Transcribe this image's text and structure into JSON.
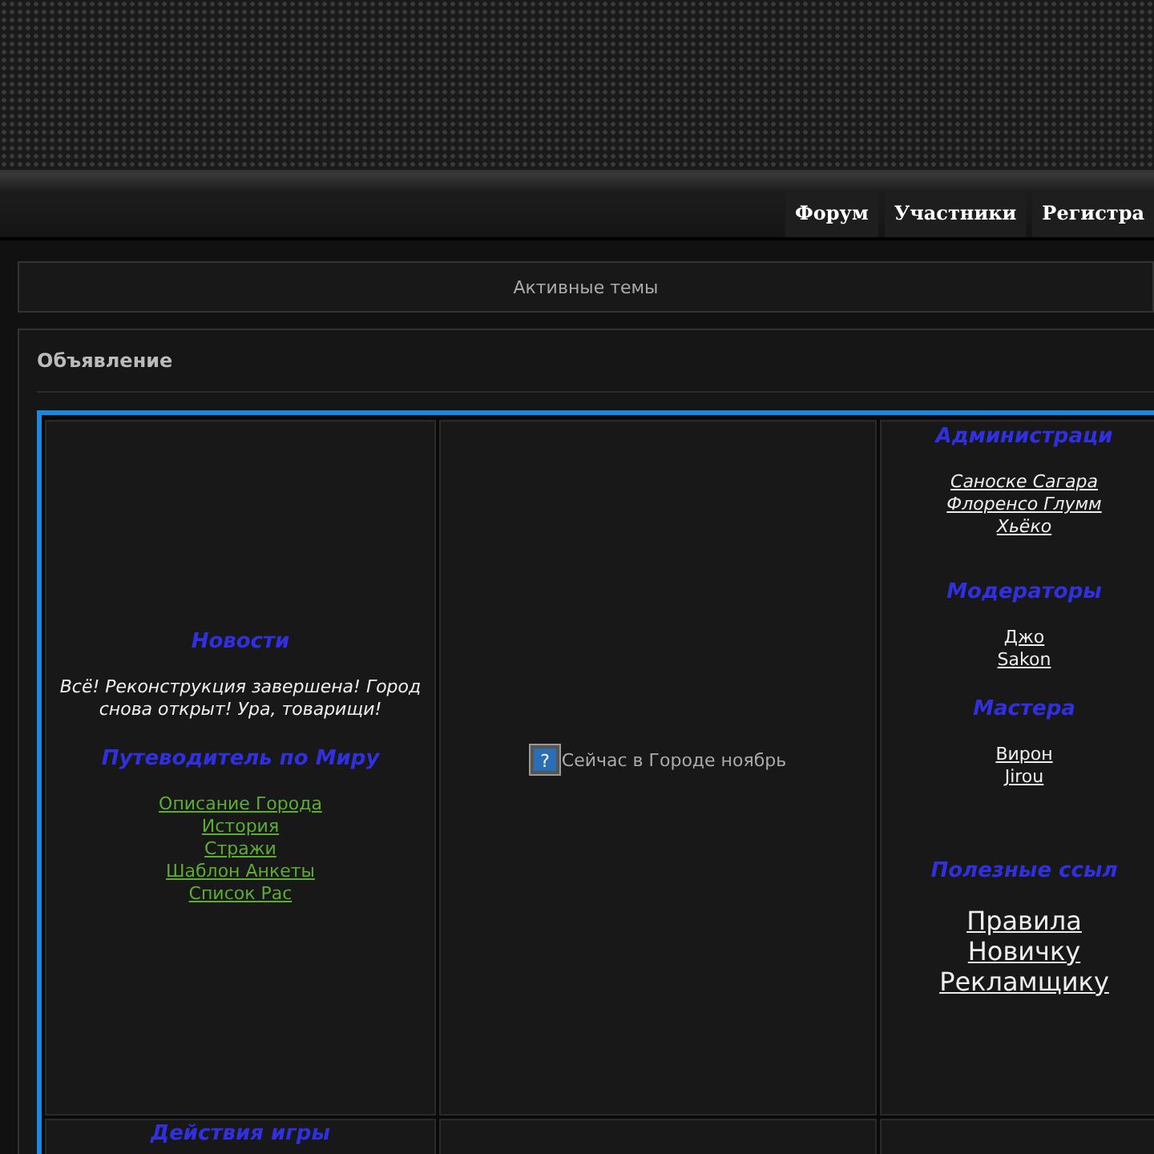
{
  "nav": {
    "tabs": [
      {
        "label": "Форум"
      },
      {
        "label": "Участники"
      },
      {
        "label": "Регистра"
      }
    ]
  },
  "active_topics": "Активные темы",
  "announcement": {
    "title": "Объявление",
    "left": {
      "news_heading": "Новости",
      "news_text": "Всё! Реконструкция завершена! Город снова открыт! Ура, товарищи!",
      "guide_heading": "Путеводитель по Миру",
      "guide_links": [
        "Описание Города",
        "История",
        "Стражи",
        "Шаблон Анкеты",
        "Список Рас"
      ]
    },
    "center": {
      "icon_glyph": "?",
      "text": "Сейчас в Городе ноябрь"
    },
    "right": {
      "sections": [
        {
          "heading": "Администраци",
          "kind": "italic",
          "links": [
            "Саноске Сагара",
            "Флоренсо Глумм",
            "Хьёко"
          ]
        },
        {
          "heading": "Модераторы",
          "kind": "plain",
          "links": [
            "Джо",
            "Sakon"
          ]
        },
        {
          "heading": "Мастера",
          "kind": "plain",
          "links": [
            "Вирон",
            "Jirou"
          ]
        },
        {
          "heading": "Полезные ссыл",
          "kind": "large",
          "links": [
            "Правила",
            "Новичку",
            "Рекламщику"
          ]
        }
      ]
    },
    "row2_heading": "Действия игры"
  }
}
